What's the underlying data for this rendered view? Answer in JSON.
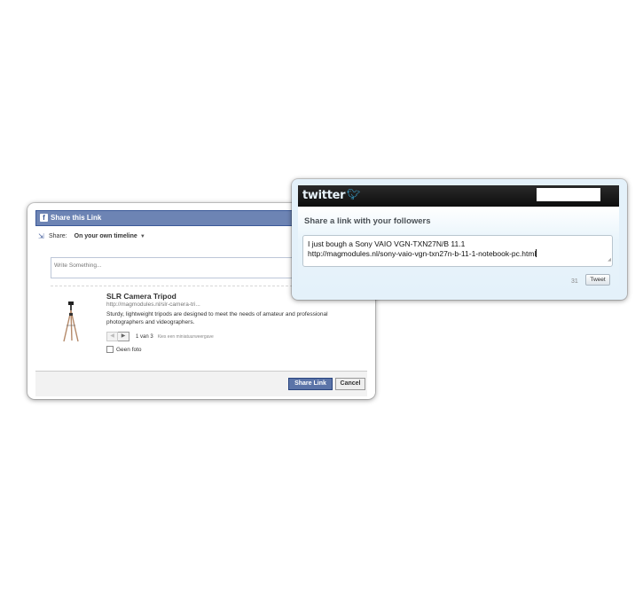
{
  "facebook": {
    "header_title": "Share this Link",
    "header_icon": "facebook-f-icon",
    "share_label": "Share:",
    "audience": "On your own timeline",
    "message_placeholder": "Write Something...",
    "preview": {
      "title": "SLR Camera Tripod",
      "url": "http://magmodules.nl/slr-camera-tri...",
      "description": "Sturdy, lightweight tripods are designed to meet the needs of amateur and professional photographers and videographers.",
      "pager_count": "1 van 3",
      "pager_hint": "Kies een miniatuurweergave",
      "no_photo_label": "Geen foto",
      "no_photo_checked": false
    },
    "buttons": {
      "share": "Share Link",
      "cancel": "Cancel"
    },
    "colors": {
      "header": "#6d84b4",
      "share_button": "#5b74a8"
    }
  },
  "twitter": {
    "logo_text": "twitter",
    "logo_icon": "twitter-bird-icon",
    "heading": "Share a link with your followers",
    "tweet_line1": "I just bough a Sony VAIO VGN-TXN27N/B 11.1",
    "tweet_line2": "http://magmodules.nl/sony-vaio-vgn-txn27n-b-11-1-notebook-pc.html",
    "char_count": "31",
    "tweet_button": "Tweet",
    "colors": {
      "topbar": "#111111",
      "body": "#e4f1fa"
    }
  }
}
